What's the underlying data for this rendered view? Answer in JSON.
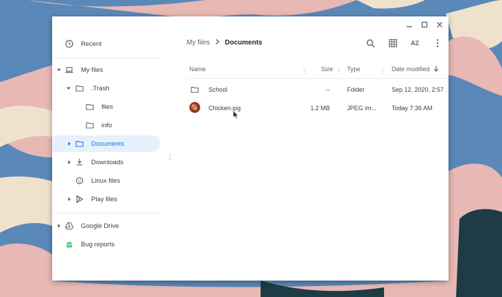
{
  "colors": {
    "accent": "#1a73e8",
    "selected_bg": "#e8f0fe",
    "wallpaper": "#5a88b8"
  },
  "window_controls": {
    "minimize_icon": "minimize-icon",
    "maximize_icon": "maximize-icon",
    "close_icon": "close-icon"
  },
  "sidebar": {
    "recent": {
      "label": "Recent",
      "icon": "clock-icon"
    },
    "my_files": {
      "label": "My files",
      "icon": "laptop-icon"
    },
    "trash": {
      "label": ".Trash",
      "icon": "folder-icon"
    },
    "files": {
      "label": "files",
      "icon": "folder-icon"
    },
    "info": {
      "label": "info",
      "icon": "folder-icon"
    },
    "documents": {
      "label": "Documents",
      "icon": "folder-icon"
    },
    "downloads": {
      "label": "Downloads",
      "icon": "download-icon"
    },
    "linux_files": {
      "label": "Linux files",
      "icon": "linux-icon"
    },
    "play_files": {
      "label": "Play files",
      "icon": "play-icon"
    },
    "google_drive": {
      "label": "Google Drive",
      "icon": "drive-icon"
    },
    "bug_reports": {
      "label": "Bug reports",
      "icon": "android-icon"
    }
  },
  "breadcrumb": {
    "root": "My files",
    "separator": ">",
    "current": "Documents"
  },
  "toolbar": {
    "search_icon": "search-icon",
    "grid_icon": "grid-view-icon",
    "sort_label": "AZ",
    "more_icon": "more-vert-icon"
  },
  "columns": {
    "name": "Name",
    "size": "Size",
    "type": "Type",
    "date": "Date modified"
  },
  "rows": [
    {
      "name": "School",
      "size": "--",
      "type": "Folder",
      "date": "Sep 12, 2020, 2:57 ...",
      "icon": "folder-icon"
    },
    {
      "name": "Chicken.jpg",
      "size": "1.2 MB",
      "type": "JPEG im...",
      "date": "Today 7:36 AM",
      "icon": "image-thumbnail"
    }
  ]
}
